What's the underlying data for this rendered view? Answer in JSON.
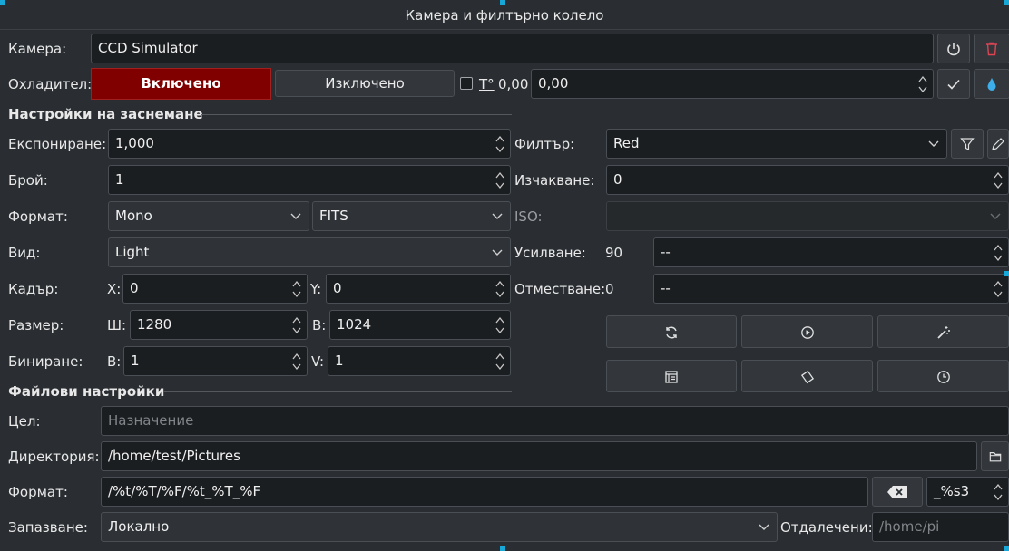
{
  "title": "Камера и филтърно колело",
  "camera": {
    "label": "Камера:",
    "value": "CCD Simulator",
    "power_icon": "power-icon",
    "delete_icon": "trash-icon"
  },
  "cooler": {
    "label": "Охладител:",
    "on_label": "Включено",
    "off_label": "Изключено",
    "temp_label": "T°",
    "temp_value": "0,00",
    "temp_input": "0,00",
    "on_color": "#800000"
  },
  "capture": {
    "section": "Настройки на заснемане",
    "exposure_label": "Експониране:",
    "exposure_value": "1,000",
    "count_label": "Брой:",
    "count_value": "1",
    "format_label": "Формат:",
    "format_color": "Mono",
    "format_file": "FITS",
    "type_label": "Вид:",
    "type_value": "Light",
    "frame_label": "Кадър:",
    "x_label": "X:",
    "x_value": "0",
    "y_label": "Y:",
    "y_value": "0",
    "size_label": "Размер:",
    "w_label": "Ш:",
    "w_value": "1280",
    "h_label": "В:",
    "h_value": "1024",
    "bin_label": "Биниране:",
    "binx_label": "В:",
    "binx_value": "1",
    "biny_label": "V:",
    "biny_value": "1",
    "filter_label": "Филтър:",
    "filter_value": "Red",
    "delay_label": "Изчакване:",
    "delay_value": "0",
    "iso_label": "ISO:",
    "gain_label": "Усилване:",
    "gain_value": "90",
    "gain_input": "--",
    "offset_label": "Отместване:",
    "offset_value": "0",
    "offset_input": "--"
  },
  "file": {
    "section": "Файлови настройки",
    "target_label": "Цел:",
    "target_placeholder": "Назначение",
    "dir_label": "Директория:",
    "dir_value": "/home/test/Pictures",
    "format_label": "Формат:",
    "format_value": "/%t/%T/%F/%t_%T_%F",
    "suffix_value": "_%s3",
    "save_label": "Запазване:",
    "save_value": "Локално",
    "remote_label": "Отдалечени:",
    "remote_placeholder": "/home/pi"
  }
}
